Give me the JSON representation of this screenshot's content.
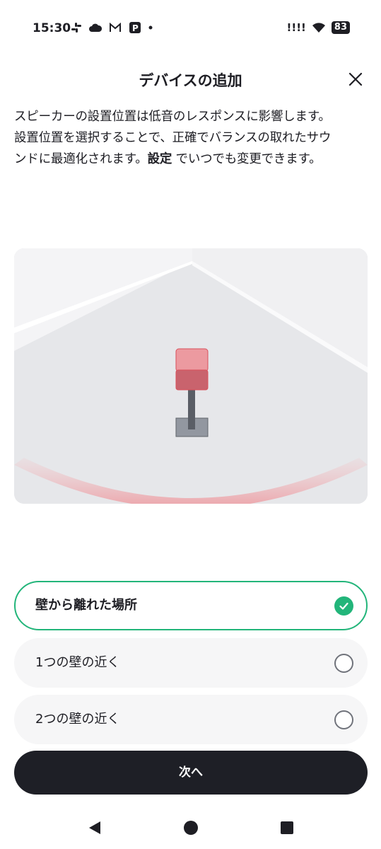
{
  "status_bar": {
    "time": "15:30",
    "left_icons": [
      "slack-icon",
      "cloud-icon",
      "gmail-icon",
      "app-icon",
      "dot-icon"
    ],
    "signal": "!!!!",
    "battery": "83"
  },
  "header": {
    "title": "デバイスの追加",
    "close_icon": "close-icon"
  },
  "description": {
    "line1": "スピーカーの設置位置は低音のレスポンスに影響します。",
    "line2": "設置位置を選択することで、正確でバランスの取れたサウ",
    "line3_pre": "ンドに最適化されます。",
    "line3_bold": "設定",
    "line3_post": " でいつでも変更できます。"
  },
  "options": [
    {
      "label": "壁から離れた場所",
      "selected": true
    },
    {
      "label": "1つの壁の近く",
      "selected": false
    },
    {
      "label": "2つの壁の近く",
      "selected": false
    }
  ],
  "next_button": {
    "label": "次へ"
  },
  "nav": {
    "back_icon": "back-triangle-icon",
    "home_icon": "home-circle-icon",
    "recents_icon": "recents-square-icon"
  },
  "colors": {
    "accent": "#22b57a",
    "button_dark": "#1e1f26",
    "speaker_red": "#e88890"
  }
}
